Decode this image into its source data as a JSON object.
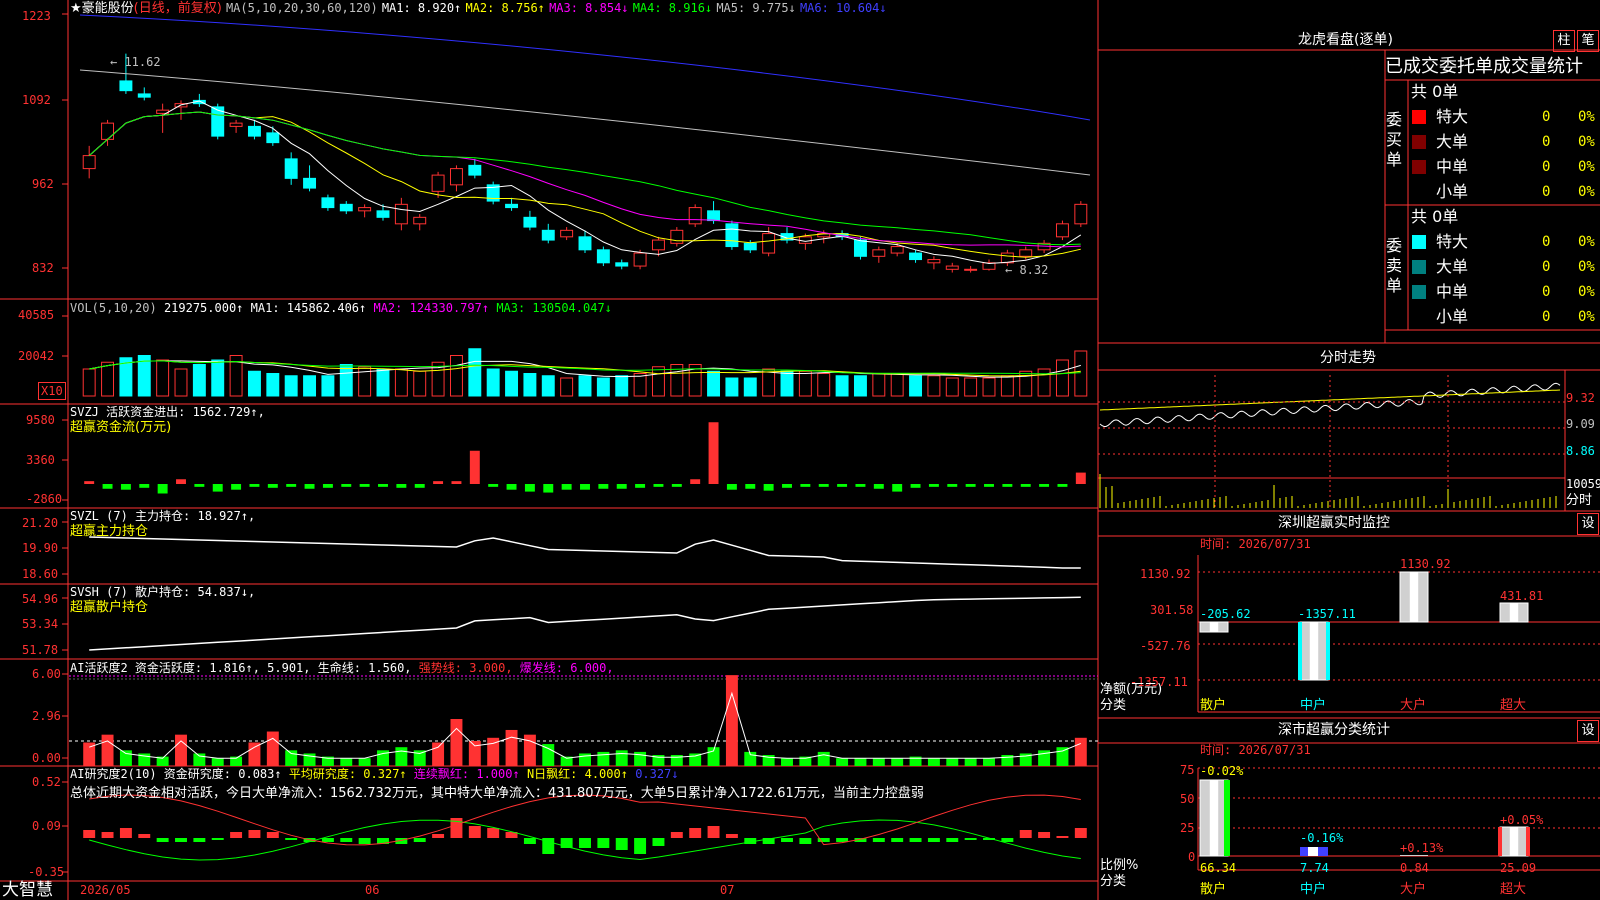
{
  "stock": {
    "title": "★豪能股份",
    "period": "(日线，前复权)",
    "ma_params": "MA(5,10,20,30,60,120)",
    "ma": [
      "MA1: 8.920↑",
      "MA2: 8.756↑",
      "MA3: 8.854↓",
      "MA4: 8.916↓",
      "MA5: 9.775↓",
      "MA6: 10.604↓"
    ],
    "hi": "11.62",
    "lo": "8.32",
    "y_ticks": [
      "1223",
      "1092",
      "962",
      "832"
    ]
  },
  "volume": {
    "label": "VOL(5,10,20)",
    "value": "219275.000↑",
    "ma": [
      "MA1: 145862.406↑",
      "MA2: 124330.797↑",
      "MA3: 130504.047↓"
    ],
    "y_ticks": [
      "40585",
      "20042"
    ],
    "unit": "X10"
  },
  "svzj": {
    "label": "SVZJ  活跃资金进出: 1562.729↑,",
    "sub": "超赢资金流(万元)",
    "y_ticks": [
      "9580",
      "3360",
      "-2860"
    ]
  },
  "svzl": {
    "label": "SVZL (7) 主力持仓: 18.927↑,",
    "sub": "超赢主力持仓",
    "y_ticks": [
      "21.20",
      "19.90",
      "18.60"
    ]
  },
  "svsh": {
    "label": "SVSH (7) 散户持仓: 54.837↓,",
    "sub": "超赢散户持仓",
    "y_ticks": [
      "54.96",
      "53.34",
      "51.78"
    ]
  },
  "ai_active": {
    "label": "AI活跃度2 资金活跃度: 1.816↑, 5.901, 生命线: 1.560,",
    "strong": "强势线: 3.000,",
    "burst": "爆发线: 6.000,",
    "y_ticks": [
      "6.00",
      "2.96",
      "0.00"
    ]
  },
  "ai_research": {
    "label": "AI研究度2(10) 资金研究度: 0.083↑",
    "avg": "平均研究度: 0.327↑",
    "cont": "连续飘红: 1.000↑",
    "nday": "N日飘红: 4.000↑",
    "last": "0.327↓",
    "summary": "总体近期大资金相对活跃，今日大单净流入：1562.732万元，其中特大单净流入：431.807万元，大单5日累计净入1722.61万元，当前主力控盘弱",
    "y_ticks": [
      "0.52",
      "0.09",
      "-0.35"
    ]
  },
  "bottom": {
    "brand": "大智慧",
    "dates": [
      "2026/05",
      "06",
      "07"
    ]
  },
  "dragon": {
    "title": "龙虎看盘(逐单)",
    "btn1": "柱",
    "btn2": "笔",
    "header": "已成交委托单成交量统计",
    "buy": {
      "side": "委买单",
      "total": "共 0单",
      "rows": [
        {
          "name": "特大",
          "v": "0",
          "p": "0%"
        },
        {
          "name": "大单",
          "v": "0",
          "p": "0%"
        },
        {
          "name": "中单",
          "v": "0",
          "p": "0%"
        },
        {
          "name": "小单",
          "v": "0",
          "p": "0%"
        }
      ]
    },
    "sell": {
      "side": "委卖单",
      "total": "共 0单",
      "rows": [
        {
          "name": "特大",
          "v": "0",
          "p": "0%"
        },
        {
          "name": "大单",
          "v": "0",
          "p": "0%"
        },
        {
          "name": "中单",
          "v": "0",
          "p": "0%"
        },
        {
          "name": "小单",
          "v": "0",
          "p": "0%"
        }
      ]
    }
  },
  "minute": {
    "title": "分时走势",
    "y_ticks": [
      "9.32",
      "9.09",
      "8.86"
    ],
    "vol": "10059",
    "vol_label": "分时"
  },
  "sz_monitor": {
    "title": "深圳超赢实时监控",
    "btn": "设",
    "time": "时间: 2026/07/31",
    "y_ticks": [
      "1130.92",
      "301.58",
      "-527.76",
      "-1357.11"
    ],
    "unit": "净额(万元)",
    "cat": "分类",
    "bars": [
      {
        "name": "散户",
        "v": "-205.62"
      },
      {
        "name": "中户",
        "v": "-1357.11"
      },
      {
        "name": "大户",
        "v": "1130.92"
      },
      {
        "name": "超大",
        "v": "431.81"
      }
    ]
  },
  "sz_class": {
    "title": "深市超赢分类统计",
    "btn": "设",
    "time": "时间: 2026/07/31",
    "y_ticks": [
      "75",
      "50",
      "25",
      "0"
    ],
    "unit": "比例%",
    "cat": "分类",
    "bars": [
      {
        "name": "散户",
        "v": "66.34",
        "chg": "-0.02%"
      },
      {
        "name": "中户",
        "v": "7.74",
        "chg": "-0.16%"
      },
      {
        "name": "大户",
        "v": "0.84",
        "chg": "+0.13%"
      },
      {
        "name": "超大",
        "v": "25.09",
        "chg": "+0.05%"
      }
    ]
  },
  "colors": {
    "up": "#ff3232",
    "down": "#00ffff",
    "grid": "#b00000",
    "panel_border": "#ff3232"
  },
  "chart_data": {
    "type": "candlestick",
    "ohlc": [
      [
        9.85,
        10.2,
        9.7,
        10.05
      ],
      [
        10.3,
        10.6,
        10.2,
        10.55
      ],
      [
        11.2,
        11.62,
        11.0,
        11.05
      ],
      [
        11.0,
        11.1,
        10.9,
        10.95
      ],
      [
        10.7,
        10.85,
        10.4,
        10.75
      ],
      [
        10.8,
        10.9,
        10.6,
        10.85
      ],
      [
        10.9,
        11.0,
        10.8,
        10.85
      ],
      [
        10.8,
        10.85,
        10.3,
        10.35
      ],
      [
        10.5,
        10.6,
        10.4,
        10.55
      ],
      [
        10.5,
        10.6,
        10.3,
        10.35
      ],
      [
        10.4,
        10.5,
        10.2,
        10.25
      ],
      [
        10.0,
        10.1,
        9.6,
        9.7
      ],
      [
        9.7,
        9.9,
        9.5,
        9.55
      ],
      [
        9.4,
        9.45,
        9.2,
        9.25
      ],
      [
        9.3,
        9.35,
        9.15,
        9.2
      ],
      [
        9.2,
        9.3,
        9.1,
        9.25
      ],
      [
        9.2,
        9.3,
        9.05,
        9.1
      ],
      [
        9.0,
        9.4,
        8.9,
        9.3
      ],
      [
        9.0,
        9.15,
        8.9,
        9.1
      ],
      [
        9.5,
        9.8,
        9.4,
        9.75
      ],
      [
        9.6,
        9.9,
        9.5,
        9.85
      ],
      [
        9.9,
        10.0,
        9.7,
        9.75
      ],
      [
        9.6,
        9.65,
        9.3,
        9.35
      ],
      [
        9.3,
        9.4,
        9.2,
        9.25
      ],
      [
        9.1,
        9.2,
        8.9,
        8.95
      ],
      [
        8.9,
        9.0,
        8.7,
        8.75
      ],
      [
        8.8,
        8.95,
        8.75,
        8.9
      ],
      [
        8.8,
        8.9,
        8.55,
        8.6
      ],
      [
        8.6,
        8.65,
        8.35,
        8.4
      ],
      [
        8.4,
        8.45,
        8.3,
        8.35
      ],
      [
        8.35,
        8.6,
        8.3,
        8.55
      ],
      [
        8.6,
        8.8,
        8.5,
        8.75
      ],
      [
        8.7,
        8.95,
        8.65,
        8.9
      ],
      [
        9.0,
        9.3,
        8.95,
        9.25
      ],
      [
        9.2,
        9.35,
        9.0,
        9.05
      ],
      [
        9.0,
        9.05,
        8.6,
        8.65
      ],
      [
        8.7,
        8.75,
        8.55,
        8.6
      ],
      [
        8.55,
        8.95,
        8.5,
        8.85
      ],
      [
        8.85,
        8.95,
        8.7,
        8.75
      ],
      [
        8.7,
        8.85,
        8.6,
        8.8
      ],
      [
        8.8,
        8.9,
        8.7,
        8.85
      ],
      [
        8.85,
        8.9,
        8.75,
        8.8
      ],
      [
        8.75,
        8.8,
        8.45,
        8.5
      ],
      [
        8.5,
        8.65,
        8.4,
        8.6
      ],
      [
        8.55,
        8.7,
        8.5,
        8.65
      ],
      [
        8.55,
        8.6,
        8.4,
        8.45
      ],
      [
        8.4,
        8.5,
        8.3,
        8.45
      ],
      [
        8.3,
        8.4,
        8.25,
        8.35
      ],
      [
        8.3,
        8.35,
        8.25,
        8.3
      ],
      [
        8.3,
        8.45,
        8.28,
        8.4
      ],
      [
        8.4,
        8.6,
        8.35,
        8.55
      ],
      [
        8.5,
        8.65,
        8.45,
        8.6
      ],
      [
        8.6,
        8.75,
        8.55,
        8.7
      ],
      [
        8.8,
        9.05,
        8.75,
        9.0
      ],
      [
        9.0,
        9.35,
        8.95,
        9.3
      ]
    ],
    "volume": [
      12,
      15,
      17,
      18,
      16,
      12,
      14,
      16,
      18,
      11,
      10,
      9,
      9,
      9,
      14,
      13,
      12,
      12,
      11,
      15,
      18,
      21,
      12,
      11,
      10,
      9,
      8,
      9,
      8,
      9,
      10,
      13,
      14,
      14,
      11,
      8,
      8,
      12,
      11,
      11,
      10,
      9,
      9,
      10,
      10,
      9,
      9,
      8,
      8,
      8,
      9,
      11,
      12,
      16,
      20
    ],
    "ylim": [
      8.32,
      12.23
    ]
  }
}
